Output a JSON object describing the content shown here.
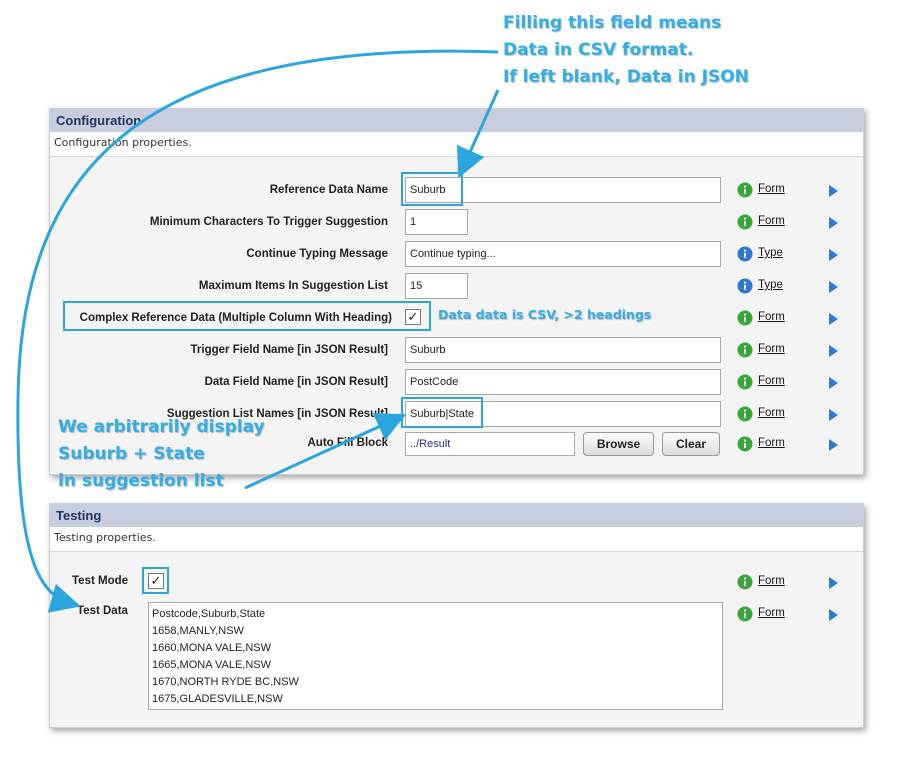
{
  "configuration": {
    "title": "Configuration",
    "description": "Configuration properties.",
    "rows": [
      {
        "label": "Reference Data Name",
        "value": "Suburb",
        "link": "Form",
        "help_color": "green"
      },
      {
        "label": "Minimum Characters To Trigger Suggestion",
        "value": "1",
        "link": "Form",
        "help_color": "green"
      },
      {
        "label": "Continue Typing Message",
        "value": "Continue typing...",
        "link": "Type",
        "help_color": "blue"
      },
      {
        "label": "Maximum Items In Suggestion List",
        "value": "15",
        "link": "Type",
        "help_color": "blue"
      },
      {
        "label": "Complex Reference Data (Multiple Column With Heading)",
        "checked": "✓",
        "link": "Form",
        "help_color": "green"
      },
      {
        "label": "Trigger Field Name [in JSON Result]",
        "value": "Suburb",
        "link": "Form",
        "help_color": "green"
      },
      {
        "label": "Data Field Name [in JSON Result]",
        "value": "PostCode",
        "link": "Form",
        "help_color": "green"
      },
      {
        "label": "Suggestion List Names [in JSON Result]",
        "value": "Suburb|State",
        "link": "Form",
        "help_color": "green"
      },
      {
        "label": "Auto Fill Block",
        "value": "../Result",
        "link": "Form",
        "help_color": "green",
        "browse_label": "Browse",
        "clear_label": "Clear"
      }
    ]
  },
  "testing": {
    "title": "Testing",
    "description": "Testing properties.",
    "test_mode": {
      "label": "Test Mode",
      "checked": "✓",
      "link": "Form"
    },
    "test_data": {
      "label": "Test Data",
      "lines": [
        "Postcode,Suburb,State",
        "1658,MANLY,NSW",
        "1660,MONA VALE,NSW",
        "1665,MONA VALE,NSW",
        "1670,NORTH RYDE BC,NSW",
        "1675,GLADESVILLE,NSW"
      ],
      "link": "Form"
    }
  },
  "annotations": {
    "csv_note": [
      "Filling this field means",
      "Data in CSV format.",
      "If left blank, Data in JSON"
    ],
    "headings_note": "Data data is CSV, >2 headings",
    "display_note": [
      "We arbitrarily display",
      "Suburb + State",
      "in suggestion list"
    ]
  },
  "colors": {
    "accent": "#33aee8",
    "header_bg": "#c9cede",
    "help_green": "#3aa63a",
    "help_blue": "#2e78d2"
  }
}
